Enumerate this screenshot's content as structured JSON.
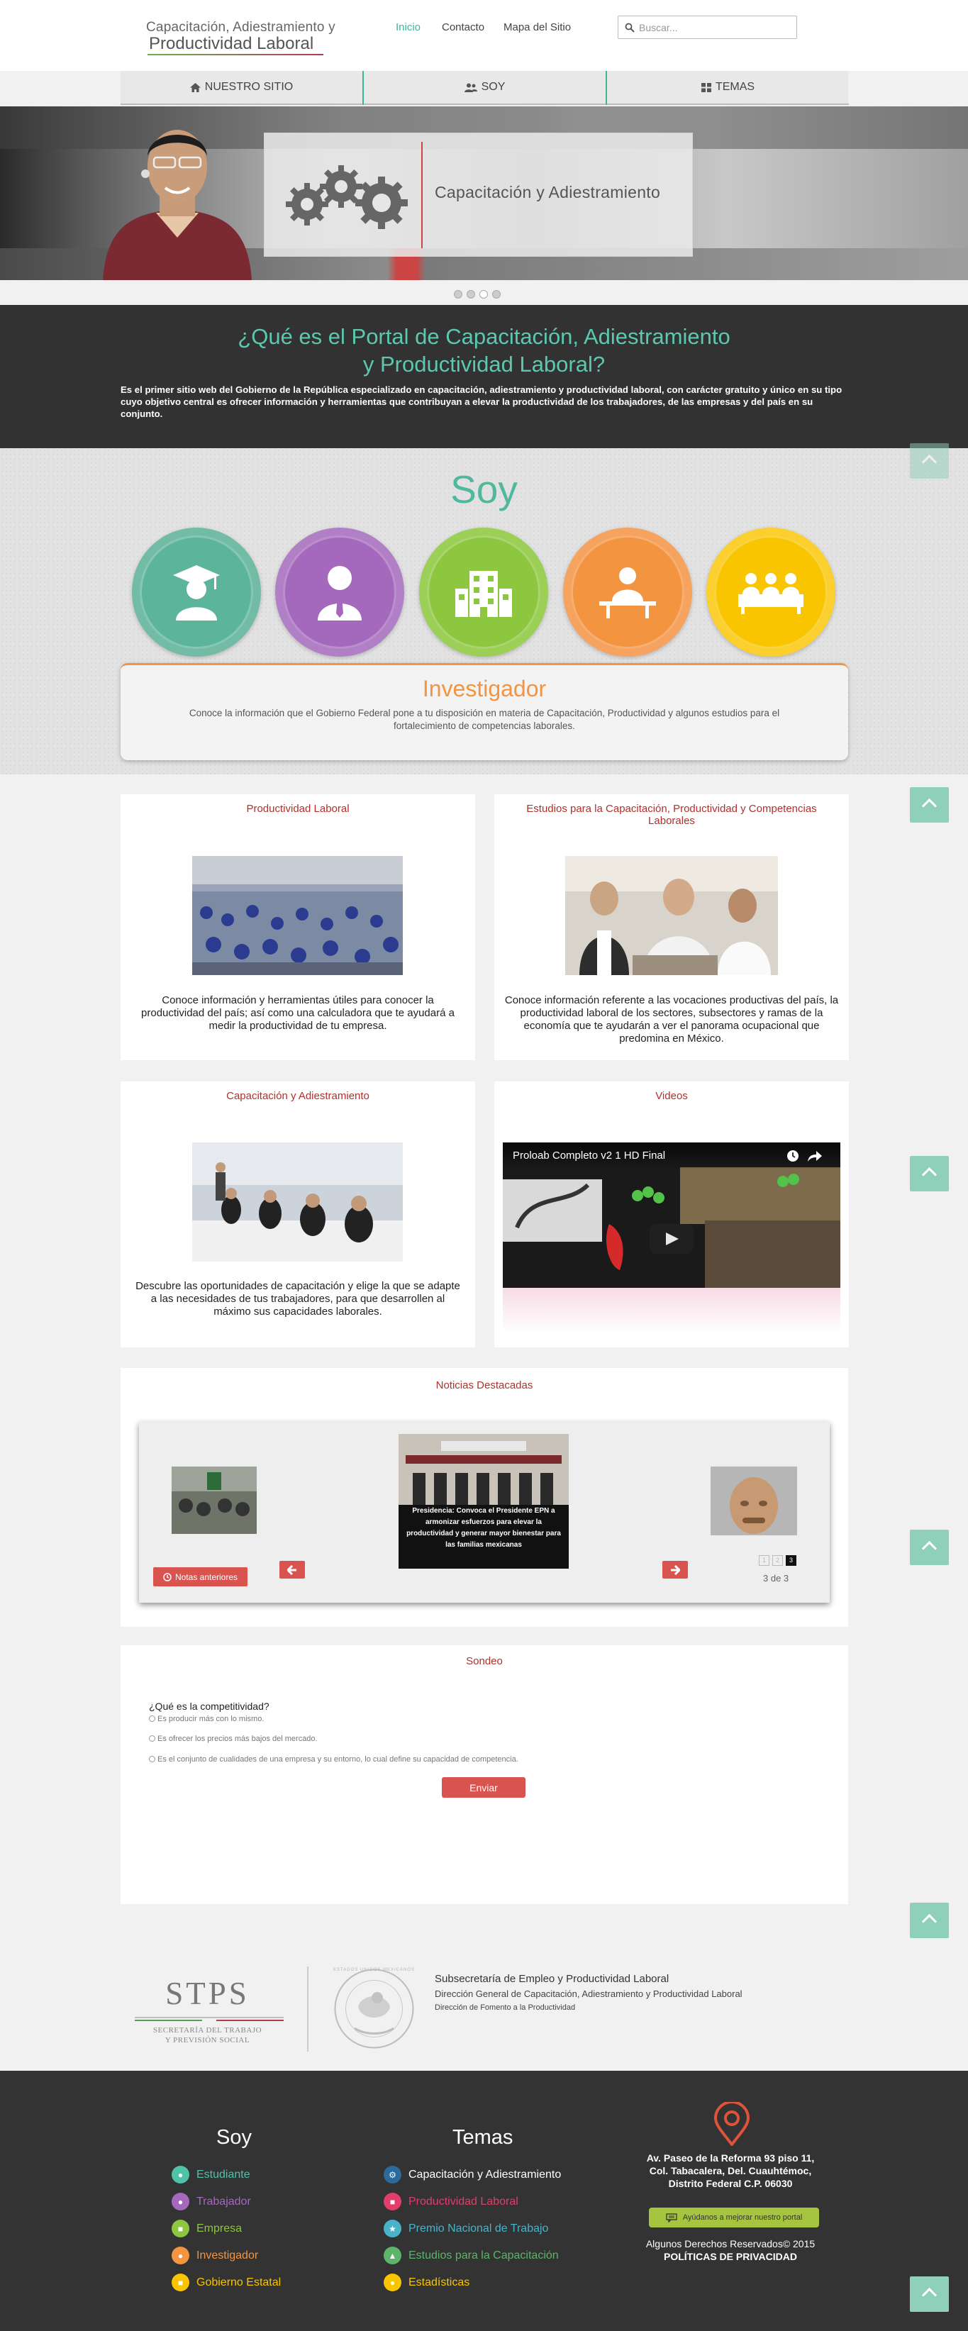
{
  "header": {
    "logo_line1": "Capacitación, Adiestramiento y",
    "logo_line2": "Productividad Laboral",
    "nav": [
      "Inicio",
      "Contacto",
      "Mapa del Sitio"
    ],
    "search_placeholder": "Buscar..."
  },
  "tabs": [
    "NUESTRO SITIO",
    "SOY",
    "TEMAS"
  ],
  "hero": {
    "caption": "Capacitación y Adiestramiento",
    "slides": 4,
    "active_slide": 3
  },
  "intro": {
    "title_line1": "¿Qué es el Portal de Capacitación, Adiestramiento",
    "title_line2": "y Productividad Laboral?",
    "text": "Es el primer sitio web del Gobierno de la República especializado en capacitación, adiestramiento y productividad laboral, con carácter gratuito y único en su tipo cuyo objetivo central es ofrecer información y herramientas que contribuyan a elevar la productividad de los trabajadores, de las empresas y del país en su conjunto."
  },
  "soy": {
    "title": "Soy",
    "profiles": [
      {
        "icon": "student-icon",
        "color": "#5cb59b"
      },
      {
        "icon": "worker-icon",
        "color": "#a469bd"
      },
      {
        "icon": "building-icon",
        "color": "#8dc63f"
      },
      {
        "icon": "researcher-icon",
        "color": "#f39440"
      },
      {
        "icon": "government-icon",
        "color": "#f9c400"
      }
    ],
    "selected_title": "Investigador",
    "selected_text": "Conoce la información que el Gobierno Federal pone a tu disposición en materia de Capacitación, Productividad y algunos estudios para el fortalecimiento de competencias laborales."
  },
  "cards": [
    {
      "title": "Productividad Laboral",
      "text": "Conoce información y herramientas útiles para conocer la productividad del país; así como una calculadora que te ayudará a medir la productividad de tu empresa."
    },
    {
      "title": "Estudios para la Capacitación, Productividad y Competencias Laborales",
      "text": "Conoce información referente a las vocaciones productivas del país, la productividad laboral de los sectores, subsectores y ramas de la economía que te ayudarán a ver el panorama ocupacional que predomina en México."
    },
    {
      "title": "Capacitación y Adiestramiento",
      "text": "Descubre las oportunidades de capacitación y elige la que se adapte a las necesidades de tus trabajadores,  para que desarrollen al máximo  sus capacidades laborales."
    },
    {
      "title": "Videos",
      "video_title": "Proloab Completo v2 1 HD Final"
    }
  ],
  "news": {
    "title": "Noticias Destacadas",
    "caption": "Presidencia: Convoca el Presidente EPN a armonizar esfuerzos para elevar la productividad y generar mayor bienestar para las familias mexicanas",
    "prev_label": "Notas anteriores",
    "pages": [
      "1",
      "2",
      "3"
    ],
    "counter": "3 de 3"
  },
  "poll": {
    "title": "Sondeo",
    "question": "¿Qué es la competitividad?",
    "options": [
      "Es producir más con lo mismo.",
      "Es ofrecer los precios más bajos del mercado.",
      "Es el conjunto de cualidades de una empresa y su entorno, lo cual define su capacidad de competencia."
    ],
    "submit": "Enviar"
  },
  "institution": {
    "stps": "STPS",
    "stps_sub1": "SECRETARÍA DEL TRABAJO",
    "stps_sub2": "Y PREVISIÓN SOCIAL",
    "line1": "Subsecretaría de Empleo y Productividad Laboral",
    "line2": "Dirección General de Capacitación, Adiestramiento y Productividad Laboral",
    "line3": "Dirección de Fomento a la Productividad",
    "seal_text": "ESTADOS UNIDOS MEXICANOS"
  },
  "footer": {
    "soy_title": "Soy",
    "soy_items": [
      {
        "label": "Estudiante",
        "color": "#4fc3a7"
      },
      {
        "label": "Trabajador",
        "color": "#a469bd"
      },
      {
        "label": "Empresa",
        "color": "#8dc63f"
      },
      {
        "label": "Investigador",
        "color": "#f39440"
      },
      {
        "label": "Gobierno Estatal",
        "color": "#f9c400"
      }
    ],
    "temas_title": "Temas",
    "temas_items": [
      {
        "label": "Capacitación y Adiestramiento",
        "color": "#ffffff",
        "icon_color": "#2b6a9a"
      },
      {
        "label": "Productividad Laboral",
        "color": "#e23d6b",
        "icon_color": "#e23d6b"
      },
      {
        "label": "Premio Nacional de Trabajo",
        "color": "#49b3c9",
        "icon_color": "#49b3c9"
      },
      {
        "label": "Estudios para la Capacitación",
        "color": "#5cb56a",
        "icon_color": "#5cb56a"
      },
      {
        "label": "Estadísticas",
        "color": "#f9c400",
        "icon_color": "#f9c400"
      }
    ],
    "address": [
      "Av. Paseo de la Reforma 93 piso 11,",
      "Col. Tabacalera, Del. Cuauhtémoc,",
      "Distrito Federal C.P. 06030"
    ],
    "feedback": "Ayúdanos a mejorar nuestro portal",
    "rights": "Algunos Derechos Reservados© 2015",
    "privacy": "POLÍTICAS DE PRIVACIDAD"
  }
}
